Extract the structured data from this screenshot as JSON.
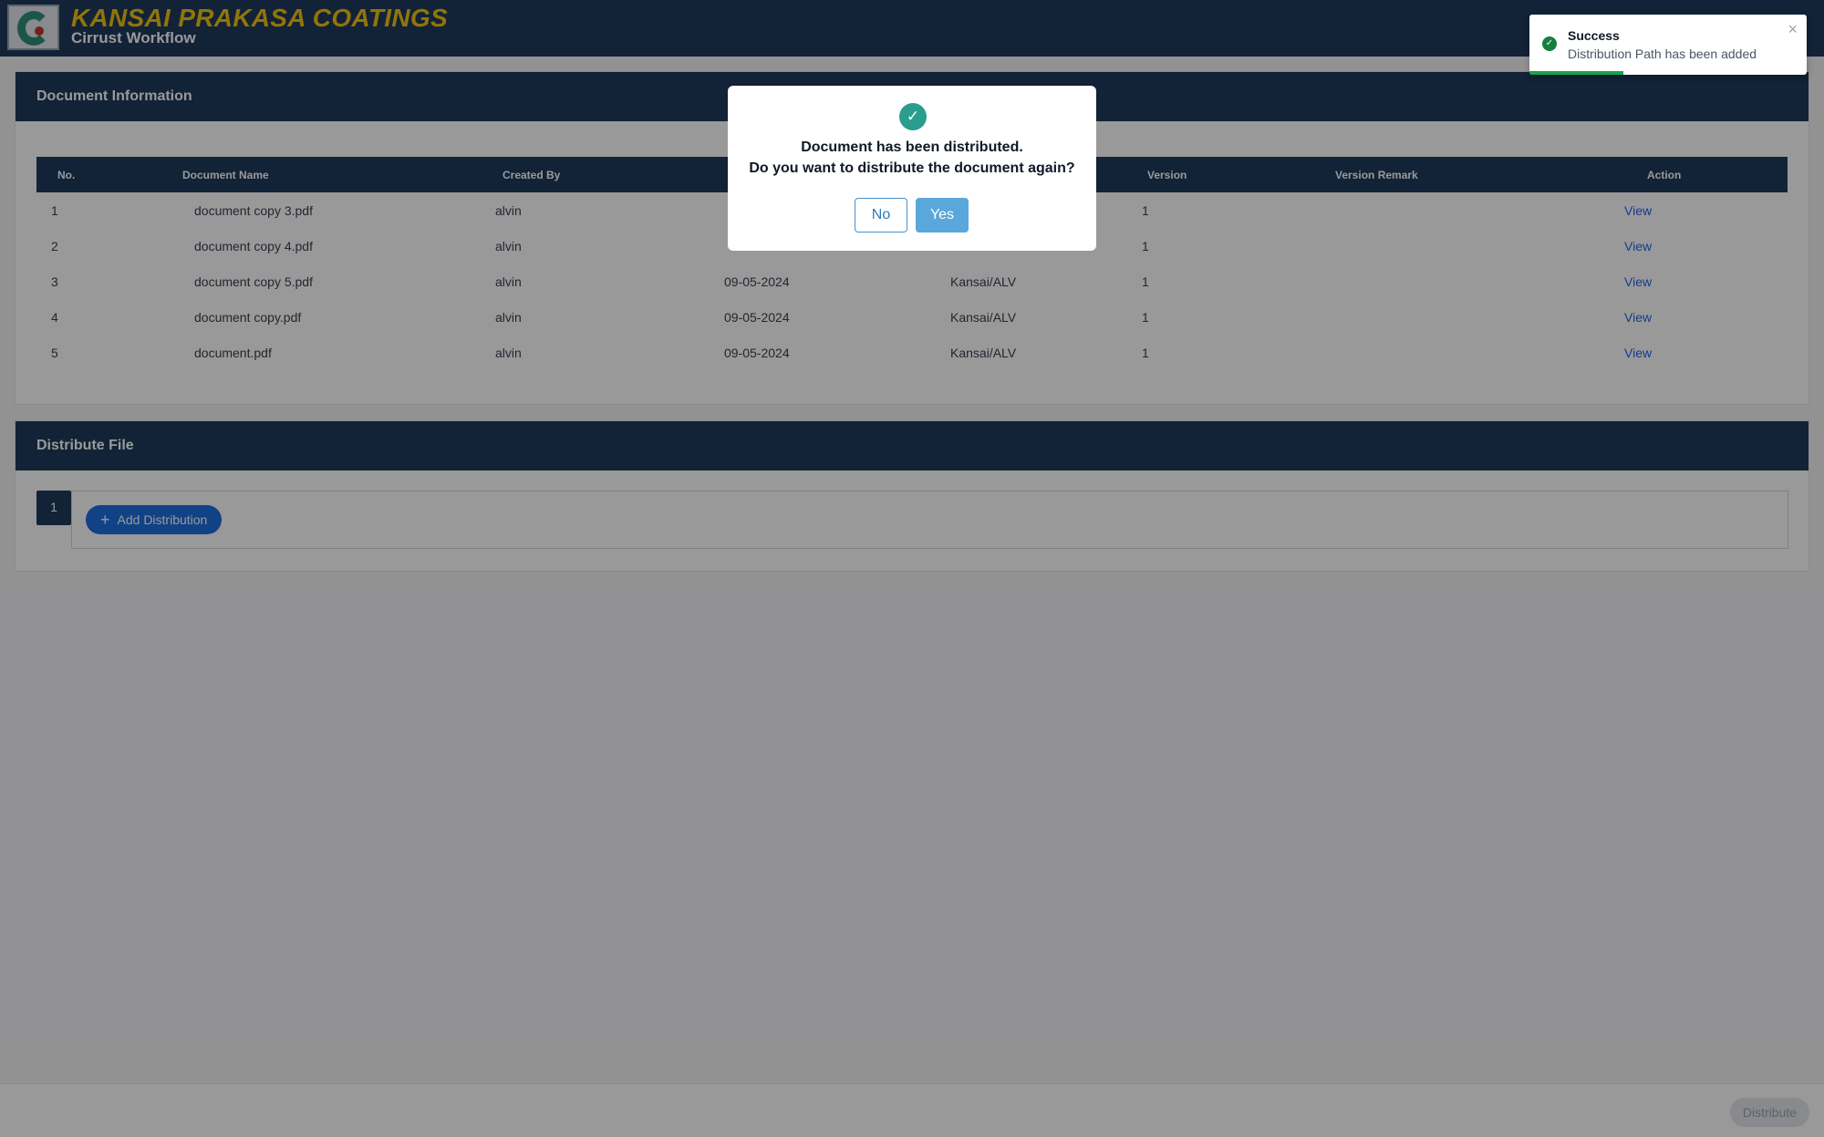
{
  "header": {
    "brand": "KANSAI PRAKASA COATINGS",
    "subtitle": "Cirrust Workflow"
  },
  "doc_info": {
    "title": "Document Information",
    "columns": [
      "No.",
      "Document Name",
      "Created By",
      "",
      "",
      "Version",
      "Version Remark",
      "Action"
    ],
    "rows": [
      {
        "no": "1",
        "name": "document copy 3.pdf",
        "created_by": "alvin",
        "date": "",
        "path": "",
        "version": "1",
        "remark": "",
        "action": "View"
      },
      {
        "no": "2",
        "name": "document copy 4.pdf",
        "created_by": "alvin",
        "date": "",
        "path": "",
        "version": "1",
        "remark": "",
        "action": "View"
      },
      {
        "no": "3",
        "name": "document copy 5.pdf",
        "created_by": "alvin",
        "date": "09-05-2024",
        "path": "Kansai/ALV",
        "version": "1",
        "remark": "",
        "action": "View"
      },
      {
        "no": "4",
        "name": "document copy.pdf",
        "created_by": "alvin",
        "date": "09-05-2024",
        "path": "Kansai/ALV",
        "version": "1",
        "remark": "",
        "action": "View"
      },
      {
        "no": "5",
        "name": "document.pdf",
        "created_by": "alvin",
        "date": "09-05-2024",
        "path": "Kansai/ALV",
        "version": "1",
        "remark": "",
        "action": "View"
      }
    ]
  },
  "distribute": {
    "title": "Distribute File",
    "tab_label": "1",
    "add_label": "Add Distribution"
  },
  "footer": {
    "distribute_label": "Distribute"
  },
  "dialog": {
    "icon": "check-icon",
    "line1": "Document has been distributed.",
    "line2": "Do you want to distribute the document again?",
    "no_label": "No",
    "yes_label": "Yes"
  },
  "toast": {
    "title": "Success",
    "message": "Distribution Path has been added",
    "close_glyph": "×",
    "progress": 0.34
  },
  "colors": {
    "header_bg": "#1f3a5c",
    "brand_yellow": "#f1c40f",
    "link_blue": "#2563eb",
    "success_green": "#16a34a",
    "dialog_check": "#2a9d8f",
    "yes_button": "#5aa7dc"
  }
}
